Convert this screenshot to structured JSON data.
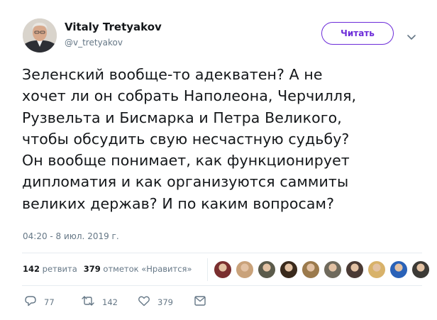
{
  "author": {
    "name": "Vitaly Tretyakov",
    "handle": "@v_tretyakov"
  },
  "follow_button": {
    "label": "Читать",
    "color": "#6c2bd9"
  },
  "menu": {
    "icon": "chevron-down-icon"
  },
  "tweet": {
    "text": "Зеленский вообще-то адекватен? А не\nхочет ли он собрать Наполеона, Черчилля,\nРузвельта и Бисмарка и Петра Великого,\nчтобы обсудить свую несчастную судьбу?\nОн вообще понимает, как функционирует\nдипломатия и как организуются саммиты\nвеликих держав? И по каким вопросам?",
    "timestamp": "04:20 - 8 июл. 2019 г."
  },
  "stats": {
    "retweets_count": "142",
    "retweets_label": "ретвита",
    "likes_count": "379",
    "likes_label": "отметок «Нравится»"
  },
  "likers": [
    {
      "name": "liker-1",
      "color": "#7a2f2f"
    },
    {
      "name": "liker-2",
      "color": "#c9a27a"
    },
    {
      "name": "liker-3",
      "color": "#5b5b4b"
    },
    {
      "name": "liker-4",
      "color": "#3a2a1c"
    },
    {
      "name": "liker-5",
      "color": "#9b7a4c"
    },
    {
      "name": "liker-6",
      "color": "#6f6a5c"
    },
    {
      "name": "liker-7",
      "color": "#4a3a34"
    },
    {
      "name": "liker-8",
      "color": "#d8b26a"
    },
    {
      "name": "liker-9",
      "color": "#2a62b8"
    },
    {
      "name": "liker-10",
      "color": "#3c3a36"
    }
  ],
  "actions": {
    "reply_icon": "reply-icon",
    "reply_count": "77",
    "retweet_icon": "retweet-icon",
    "retweet_count": "142",
    "like_icon": "heart-icon",
    "like_count": "379",
    "message_icon": "envelope-icon"
  }
}
